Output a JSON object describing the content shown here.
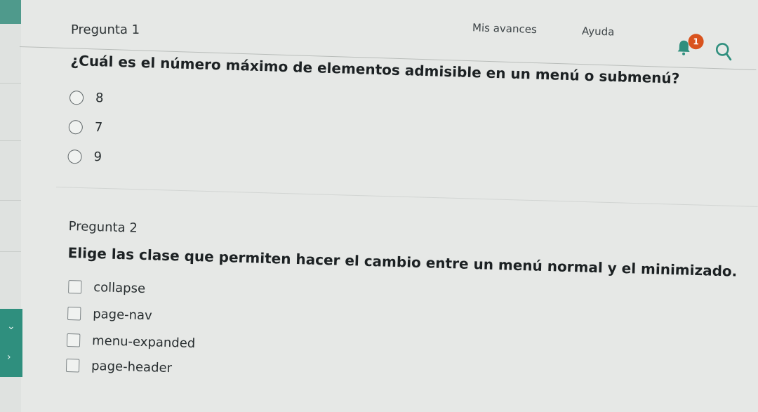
{
  "header": {
    "nav_links": [
      "Mis avances",
      "Ayuda"
    ],
    "notification_count": "1",
    "accent_color": "#2f8f7e",
    "badge_color": "#d9531e",
    "icons": [
      "bell-icon",
      "search-icon"
    ]
  },
  "questions": [
    {
      "label": "Pregunta 1",
      "text": "¿Cuál es el número máximo de elementos admisible en un menú o submenú?",
      "type": "radio",
      "options": [
        "8",
        "7",
        "9"
      ]
    },
    {
      "label": "Pregunta 2",
      "text": "Elige las clase que permiten hacer el cambio entre un menú normal y el minimizado.",
      "type": "checkbox",
      "options": [
        "collapse",
        "page-nav",
        "menu-expanded",
        "page-header"
      ]
    }
  ]
}
